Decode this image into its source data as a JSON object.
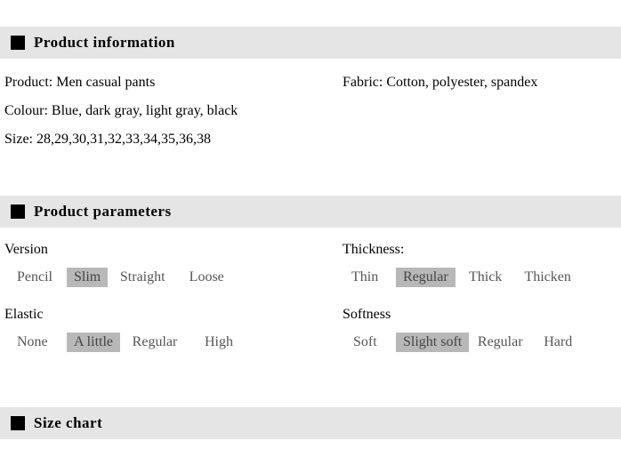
{
  "sections": {
    "product_info": {
      "title": "Product information",
      "product_label": "Product:",
      "product_value": "Men casual pants",
      "fabric_label": "Fabric:",
      "fabric_value": "Cotton, polyester, spandex",
      "colour_label": "Colour:",
      "colour_value": "Blue, dark gray, light gray, black",
      "size_label": "Size:",
      "size_value": "28,29,30,31,32,33,34,35,36,38"
    },
    "product_params": {
      "title": "Product parameters",
      "version": {
        "label": "Version",
        "options": [
          "Pencil",
          "Slim",
          "Straight",
          "Loose"
        ],
        "selected": "Slim"
      },
      "thickness": {
        "label": "Thickness:",
        "options": [
          "Thin",
          "Regular",
          "Thick",
          "Thicken"
        ],
        "selected": "Regular"
      },
      "elastic": {
        "label": "Elastic",
        "options": [
          "None",
          "A little",
          "Regular",
          "High"
        ],
        "selected": "A little"
      },
      "softness": {
        "label": "Softness",
        "options": [
          "Soft",
          "Slight soft",
          "Regular",
          "Hard"
        ],
        "selected": "Slight soft"
      }
    },
    "size_chart": {
      "title": "Size chart"
    }
  }
}
